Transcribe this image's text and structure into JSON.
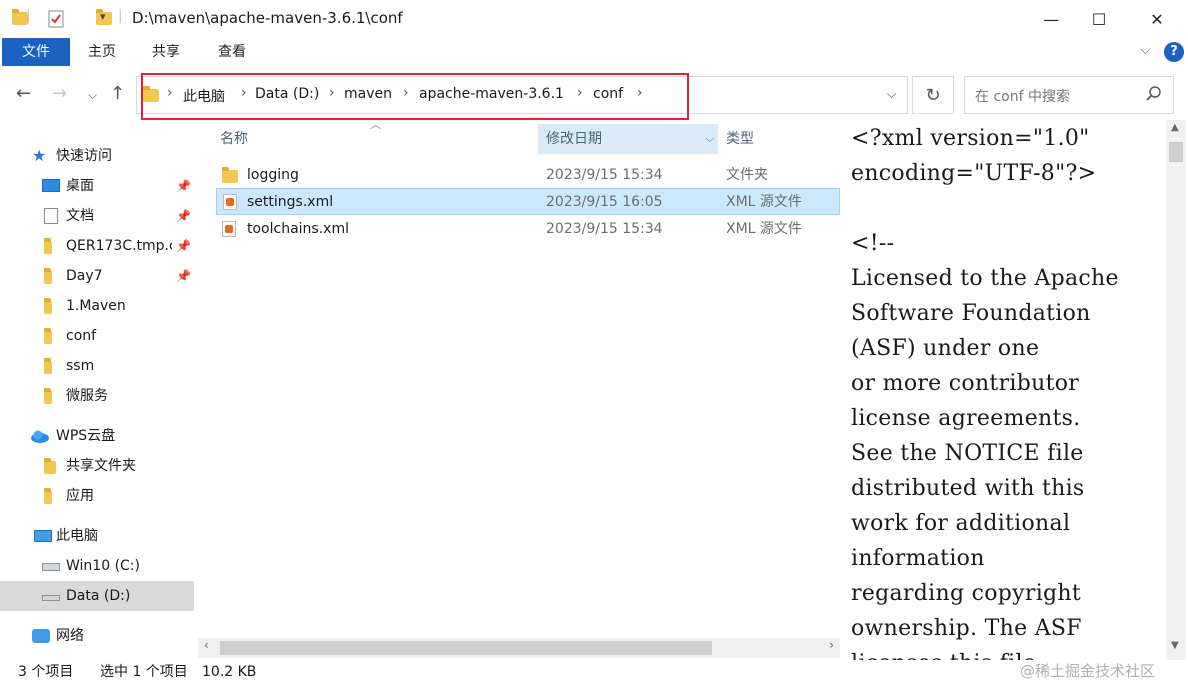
{
  "window": {
    "title": "D:\\maven\\apache-maven-3.6.1\\conf",
    "minimize": "—",
    "maximize": "☐",
    "close": "✕"
  },
  "ribbon": {
    "tabs": [
      "文件",
      "主页",
      "共享",
      "查看"
    ]
  },
  "address": {
    "crumbs": [
      "此电脑",
      "Data (D:)",
      "maven",
      "apache-maven-3.6.1",
      "conf"
    ],
    "search_placeholder": "在 conf 中搜索"
  },
  "nav": {
    "quick_access": "快速访问",
    "items": [
      {
        "label": "桌面",
        "pinned": true
      },
      {
        "label": "文档",
        "pinned": true
      },
      {
        "label": "QER173C.tmp.c",
        "pinned": true
      },
      {
        "label": "Day7",
        "pinned": true
      },
      {
        "label": "1.Maven",
        "pinned": false
      },
      {
        "label": "conf",
        "pinned": false
      },
      {
        "label": "ssm",
        "pinned": false
      },
      {
        "label": "微服务",
        "pinned": false
      }
    ],
    "wps": "WPS云盘",
    "wps_items": [
      "共享文件夹",
      "应用"
    ],
    "this_pc": "此电脑",
    "drives": [
      "Win10 (C:)",
      "Data (D:)"
    ],
    "network": "网络"
  },
  "columns": {
    "name": "名称",
    "date": "修改日期",
    "type": "类型"
  },
  "files": [
    {
      "name": "logging",
      "date": "2023/9/15 15:34",
      "type": "文件夹",
      "kind": "folder"
    },
    {
      "name": "settings.xml",
      "date": "2023/9/15 16:05",
      "type": "XML 源文件",
      "kind": "xml"
    },
    {
      "name": "toolchains.xml",
      "date": "2023/9/15 15:34",
      "type": "XML 源文件",
      "kind": "xml"
    }
  ],
  "preview": {
    "lines": [
      "<?xml version=\"1.0\"",
      "encoding=\"UTF-8\"?>",
      "",
      "<!--",
      "Licensed to the Apache",
      "Software Foundation",
      "(ASF) under one",
      "or more contributor",
      "license agreements.",
      "See the NOTICE file",
      "distributed with this",
      "work for additional",
      "information",
      "regarding copyright",
      "ownership.  The ASF",
      "licenses this file"
    ]
  },
  "status": {
    "count": "3 个项目",
    "selected": "选中 1 个项目",
    "size": "10.2 KB"
  },
  "watermark": "@稀土掘金技术社区",
  "colors": {
    "accent": "#1a61c2",
    "selection": "#cce8ff",
    "highlight_box": "#e0212f"
  }
}
